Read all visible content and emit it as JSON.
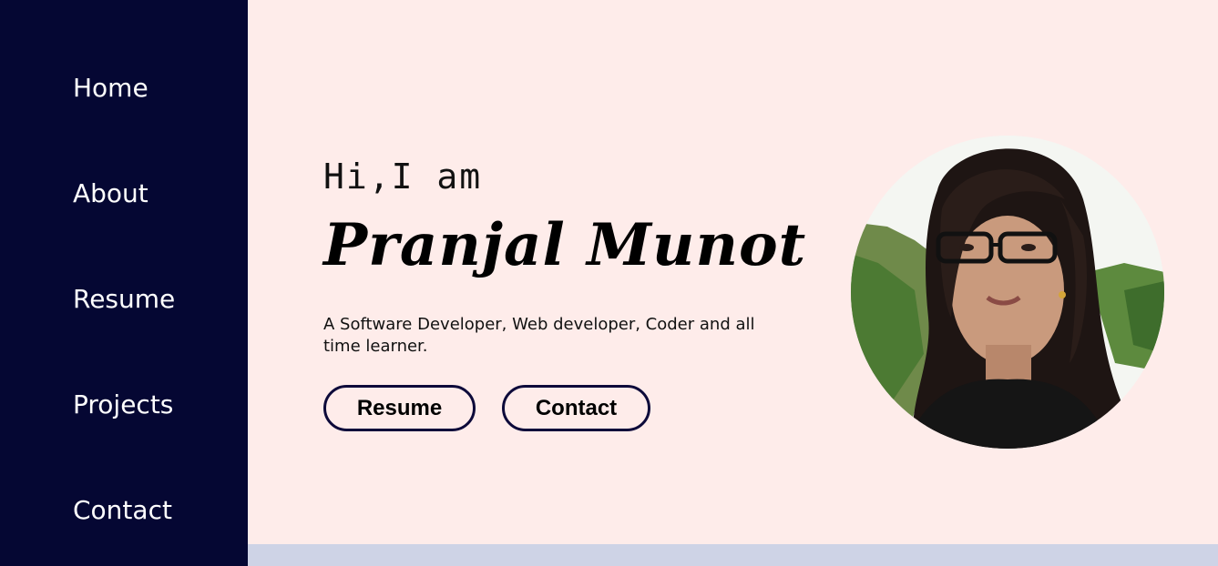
{
  "sidebar": {
    "items": [
      {
        "label": "Home"
      },
      {
        "label": "About"
      },
      {
        "label": "Resume"
      },
      {
        "label": "Projects"
      },
      {
        "label": "Contact"
      }
    ]
  },
  "hero": {
    "greeting": "Hi,I am",
    "name": "Pranjal Munot",
    "tagline": "A Software Developer, Web developer, Coder and all time learner.",
    "buttons": {
      "resume_label": "Resume",
      "contact_label": "Contact"
    }
  },
  "colors": {
    "sidebar_bg": "#050733",
    "main_bg": "#feecea",
    "footer_strip": "#ced3e6",
    "button_border": "#0d0a3a"
  },
  "icons": {
    "profile_photo": "profile-photo"
  }
}
